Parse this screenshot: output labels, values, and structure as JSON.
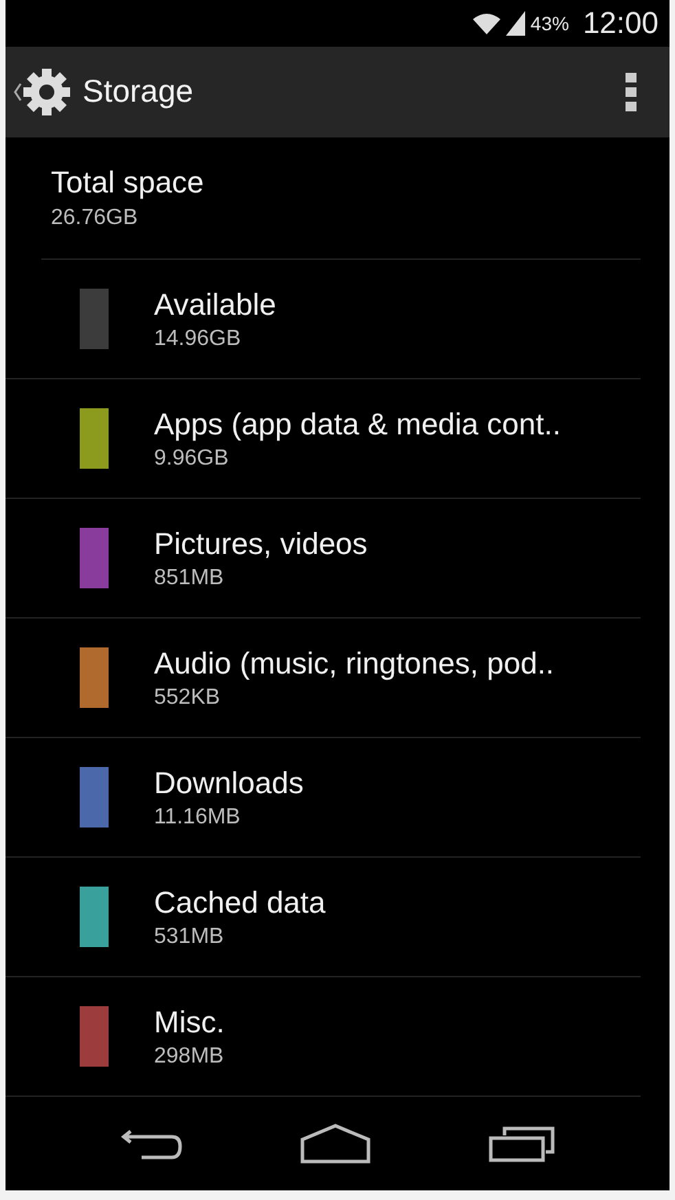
{
  "status_bar": {
    "battery": "43%",
    "time": "12:00"
  },
  "action_bar": {
    "title": "Storage"
  },
  "total": {
    "label": "Total space",
    "value": "26.76GB"
  },
  "categories": [
    {
      "name": "Available",
      "size": "14.96GB",
      "color": "#3c3c3c"
    },
    {
      "name": "Apps (app data & media cont..",
      "size": "9.96GB",
      "color": "#8c9a1e"
    },
    {
      "name": "Pictures, videos",
      "size": "851MB",
      "color": "#8a3c9c"
    },
    {
      "name": "Audio (music, ringtones, pod..",
      "size": "552KB",
      "color": "#b06a2e"
    },
    {
      "name": "Downloads",
      "size": "11.16MB",
      "color": "#4a68aa"
    },
    {
      "name": "Cached data",
      "size": "531MB",
      "color": "#3aa09c"
    },
    {
      "name": "Misc.",
      "size": "298MB",
      "color": "#9c3c3c"
    }
  ]
}
